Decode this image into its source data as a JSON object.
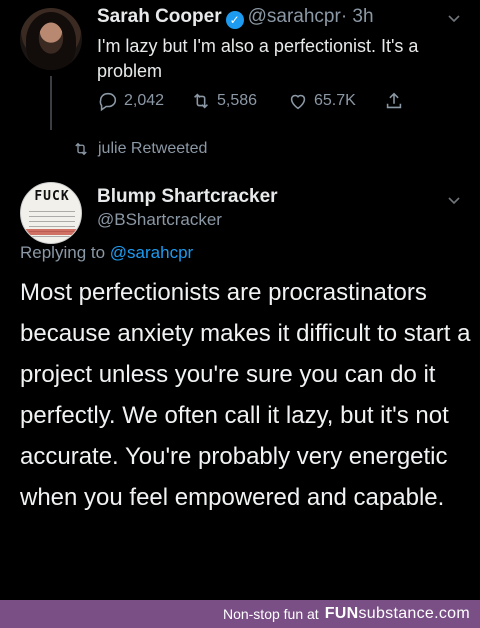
{
  "tweet1": {
    "name": "Sarah Cooper",
    "handle": "@sarahcpr",
    "time": "· 3h",
    "text": "I'm lazy but I'm also a perfectionist. It's a problem",
    "replies": "2,042",
    "retweets": "5,586",
    "likes": "65.7K"
  },
  "retweet_notice": "julie Retweeted",
  "tweet2": {
    "name": "Blump Shartcracker",
    "handle": "@BShartcracker",
    "avatar_text": "FUCK",
    "replying_prefix": "Replying to",
    "replying_to": "@sarahcpr",
    "text": "Most perfectionists are procrastinators because anxiety makes it difficult to start a project unless you're sure you can do it perfectly. We often call it lazy, but it's not accurate. You're probably very energetic when you feel empowered and capable."
  },
  "footer": {
    "tagline": "Non-stop fun at",
    "brand_main": "FUN",
    "brand_sub": "substance",
    "brand_tld": ".com"
  },
  "colors": {
    "background": "#000000",
    "accent": "#1d9bf0",
    "muted": "#8b98a5",
    "footer_bg": "#7a4f86"
  },
  "icons": [
    "verified-badge-icon",
    "chevron-down-icon",
    "reply-icon",
    "retweet-icon",
    "like-icon",
    "share-icon"
  ]
}
